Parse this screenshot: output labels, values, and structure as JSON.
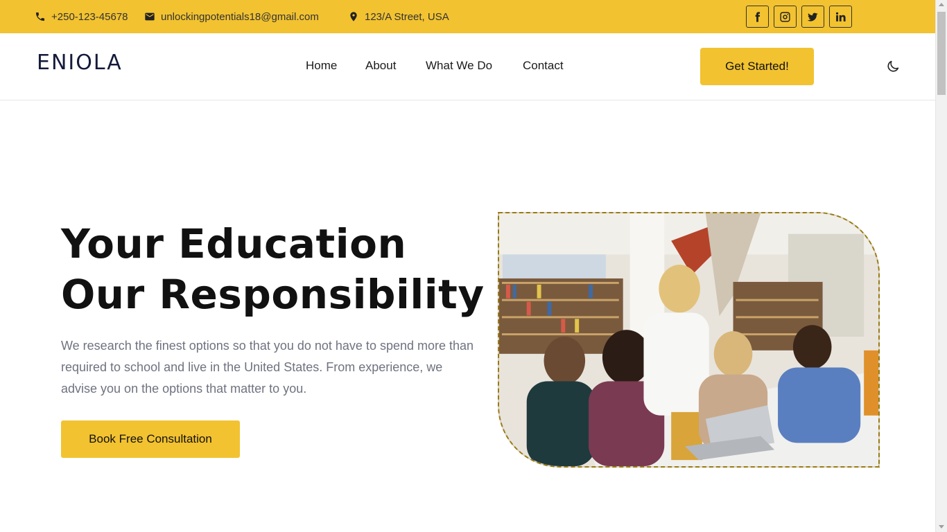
{
  "topbar": {
    "phone": "+250-123-45678",
    "email": "unlockingpotentials18@gmail.com",
    "address": "123/A Street, USA",
    "social": [
      "facebook-icon",
      "instagram-icon",
      "twitter-icon",
      "linkedin-icon"
    ]
  },
  "header": {
    "logo": "ENIOLA",
    "nav": [
      "Home",
      "About",
      "What We Do",
      "Contact"
    ],
    "cta_label": "Get Started!",
    "theme_toggle_icon": "moon-icon"
  },
  "hero": {
    "title_line1": "Your Education",
    "title_line2": "Our Responsibility",
    "description": "We research the finest options so that you do not have to spend more than required to school and live in the United States. From experience, we advise you on the options that matter to you.",
    "button_label": "Book Free Consultation",
    "image_icon": "library-students-photo"
  },
  "colors": {
    "accent": "#F2C230",
    "logo": "#141A3A",
    "text_muted": "#6f7280"
  }
}
